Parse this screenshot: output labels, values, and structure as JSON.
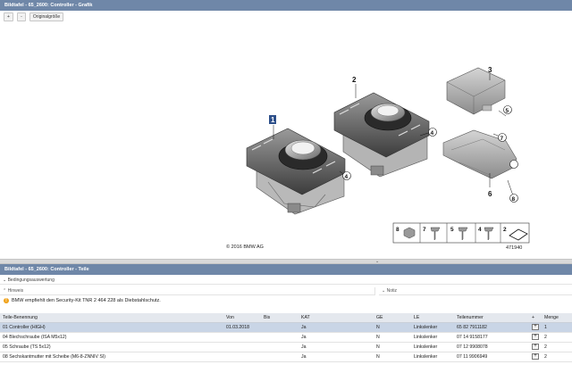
{
  "graphic_title": "Bildtafel - 65_2600: Controller - Grafik",
  "toolbar": {
    "zoom_in": "+",
    "zoom_out": "-",
    "original_size": "Originalgröße"
  },
  "diagram": {
    "callouts": [
      "1",
      "2",
      "3",
      "4",
      "4",
      "5",
      "6",
      "7",
      "8"
    ],
    "copyright": "© 2016 BMW AG",
    "image_number": "471940",
    "legend_items": [
      "8",
      "7",
      "5",
      "4",
      "2"
    ]
  },
  "parts_title": "Bildtafel - 65_2600: Controller - Teile",
  "filter_label": "Bedingungsauswertung",
  "hint_panel": {
    "label": "Hinweis",
    "text": "BMW empfiehlt den Security-Kit TNR 2 464 228 als Diebstahlschutz."
  },
  "notes_panel": {
    "label": "Notiz"
  },
  "table": {
    "headers": [
      "Teile-Benennung",
      "Von",
      "Bis",
      "KAT",
      "GE",
      "LE",
      "Teilenummer",
      "+",
      "Menge"
    ],
    "rows": [
      {
        "name": "01 Controller (HIGH)",
        "von": "01.03.2018",
        "bis": "",
        "kat": "Ja",
        "ge": "N",
        "le": "Linkslenker",
        "nr": "65 82 7911182",
        "add": "+",
        "menge": "1"
      },
      {
        "name": "04 Blechschraube (ISA M5x12)",
        "von": "",
        "bis": "",
        "kat": "Ja",
        "ge": "N",
        "le": "Linkslenker",
        "nr": "07 14 9158177",
        "add": "+",
        "menge": "2"
      },
      {
        "name": "05 Schraube (TS 5x12)",
        "von": "",
        "bis": "",
        "kat": "Ja",
        "ge": "N",
        "le": "Linkslenker",
        "nr": "07 12 9908078",
        "add": "+",
        "menge": "2"
      },
      {
        "name": "08 Sechskantmutter mit Scheibe (M6-8-ZNNIV SI)",
        "von": "",
        "bis": "",
        "kat": "Ja",
        "ge": "N",
        "le": "Linkslenker",
        "nr": "07 11 9906949",
        "add": "+",
        "menge": "2"
      }
    ]
  }
}
